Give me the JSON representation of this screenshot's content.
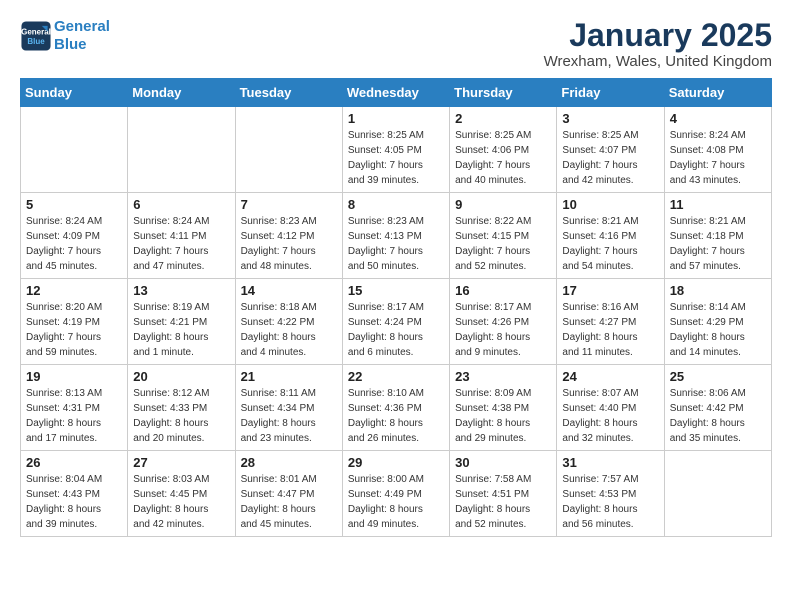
{
  "header": {
    "logo_line1": "General",
    "logo_line2": "Blue",
    "title": "January 2025",
    "subtitle": "Wrexham, Wales, United Kingdom"
  },
  "days_of_week": [
    "Sunday",
    "Monday",
    "Tuesday",
    "Wednesday",
    "Thursday",
    "Friday",
    "Saturday"
  ],
  "weeks": [
    [
      {
        "day": "",
        "info": ""
      },
      {
        "day": "",
        "info": ""
      },
      {
        "day": "",
        "info": ""
      },
      {
        "day": "1",
        "info": "Sunrise: 8:25 AM\nSunset: 4:05 PM\nDaylight: 7 hours\nand 39 minutes."
      },
      {
        "day": "2",
        "info": "Sunrise: 8:25 AM\nSunset: 4:06 PM\nDaylight: 7 hours\nand 40 minutes."
      },
      {
        "day": "3",
        "info": "Sunrise: 8:25 AM\nSunset: 4:07 PM\nDaylight: 7 hours\nand 42 minutes."
      },
      {
        "day": "4",
        "info": "Sunrise: 8:24 AM\nSunset: 4:08 PM\nDaylight: 7 hours\nand 43 minutes."
      }
    ],
    [
      {
        "day": "5",
        "info": "Sunrise: 8:24 AM\nSunset: 4:09 PM\nDaylight: 7 hours\nand 45 minutes."
      },
      {
        "day": "6",
        "info": "Sunrise: 8:24 AM\nSunset: 4:11 PM\nDaylight: 7 hours\nand 47 minutes."
      },
      {
        "day": "7",
        "info": "Sunrise: 8:23 AM\nSunset: 4:12 PM\nDaylight: 7 hours\nand 48 minutes."
      },
      {
        "day": "8",
        "info": "Sunrise: 8:23 AM\nSunset: 4:13 PM\nDaylight: 7 hours\nand 50 minutes."
      },
      {
        "day": "9",
        "info": "Sunrise: 8:22 AM\nSunset: 4:15 PM\nDaylight: 7 hours\nand 52 minutes."
      },
      {
        "day": "10",
        "info": "Sunrise: 8:21 AM\nSunset: 4:16 PM\nDaylight: 7 hours\nand 54 minutes."
      },
      {
        "day": "11",
        "info": "Sunrise: 8:21 AM\nSunset: 4:18 PM\nDaylight: 7 hours\nand 57 minutes."
      }
    ],
    [
      {
        "day": "12",
        "info": "Sunrise: 8:20 AM\nSunset: 4:19 PM\nDaylight: 7 hours\nand 59 minutes."
      },
      {
        "day": "13",
        "info": "Sunrise: 8:19 AM\nSunset: 4:21 PM\nDaylight: 8 hours\nand 1 minute."
      },
      {
        "day": "14",
        "info": "Sunrise: 8:18 AM\nSunset: 4:22 PM\nDaylight: 8 hours\nand 4 minutes."
      },
      {
        "day": "15",
        "info": "Sunrise: 8:17 AM\nSunset: 4:24 PM\nDaylight: 8 hours\nand 6 minutes."
      },
      {
        "day": "16",
        "info": "Sunrise: 8:17 AM\nSunset: 4:26 PM\nDaylight: 8 hours\nand 9 minutes."
      },
      {
        "day": "17",
        "info": "Sunrise: 8:16 AM\nSunset: 4:27 PM\nDaylight: 8 hours\nand 11 minutes."
      },
      {
        "day": "18",
        "info": "Sunrise: 8:14 AM\nSunset: 4:29 PM\nDaylight: 8 hours\nand 14 minutes."
      }
    ],
    [
      {
        "day": "19",
        "info": "Sunrise: 8:13 AM\nSunset: 4:31 PM\nDaylight: 8 hours\nand 17 minutes."
      },
      {
        "day": "20",
        "info": "Sunrise: 8:12 AM\nSunset: 4:33 PM\nDaylight: 8 hours\nand 20 minutes."
      },
      {
        "day": "21",
        "info": "Sunrise: 8:11 AM\nSunset: 4:34 PM\nDaylight: 8 hours\nand 23 minutes."
      },
      {
        "day": "22",
        "info": "Sunrise: 8:10 AM\nSunset: 4:36 PM\nDaylight: 8 hours\nand 26 minutes."
      },
      {
        "day": "23",
        "info": "Sunrise: 8:09 AM\nSunset: 4:38 PM\nDaylight: 8 hours\nand 29 minutes."
      },
      {
        "day": "24",
        "info": "Sunrise: 8:07 AM\nSunset: 4:40 PM\nDaylight: 8 hours\nand 32 minutes."
      },
      {
        "day": "25",
        "info": "Sunrise: 8:06 AM\nSunset: 4:42 PM\nDaylight: 8 hours\nand 35 minutes."
      }
    ],
    [
      {
        "day": "26",
        "info": "Sunrise: 8:04 AM\nSunset: 4:43 PM\nDaylight: 8 hours\nand 39 minutes."
      },
      {
        "day": "27",
        "info": "Sunrise: 8:03 AM\nSunset: 4:45 PM\nDaylight: 8 hours\nand 42 minutes."
      },
      {
        "day": "28",
        "info": "Sunrise: 8:01 AM\nSunset: 4:47 PM\nDaylight: 8 hours\nand 45 minutes."
      },
      {
        "day": "29",
        "info": "Sunrise: 8:00 AM\nSunset: 4:49 PM\nDaylight: 8 hours\nand 49 minutes."
      },
      {
        "day": "30",
        "info": "Sunrise: 7:58 AM\nSunset: 4:51 PM\nDaylight: 8 hours\nand 52 minutes."
      },
      {
        "day": "31",
        "info": "Sunrise: 7:57 AM\nSunset: 4:53 PM\nDaylight: 8 hours\nand 56 minutes."
      },
      {
        "day": "",
        "info": ""
      }
    ]
  ]
}
